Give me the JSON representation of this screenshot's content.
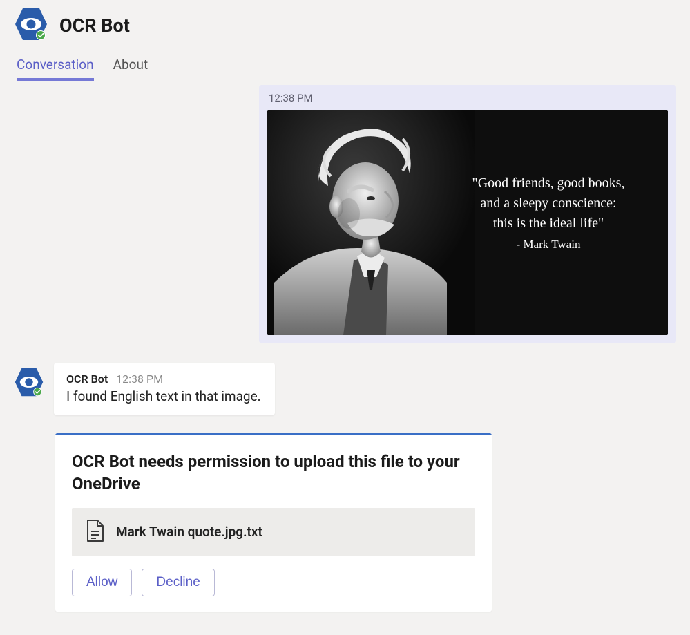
{
  "header": {
    "title": "OCR Bot"
  },
  "tabs": [
    {
      "label": "Conversation",
      "active": true
    },
    {
      "label": "About",
      "active": false
    }
  ],
  "outgoing": {
    "time": "12:38 PM",
    "quote_lines": [
      "\"Good friends, good books,",
      "and a sleepy conscience:",
      "this is the ideal life\""
    ],
    "quote_attr": "- Mark Twain"
  },
  "bot_msg": {
    "name": "OCR Bot",
    "time": "12:38 PM",
    "text": "I found English text in that image."
  },
  "consent": {
    "title": "OCR Bot needs permission to upload this file to your OneDrive",
    "filename": "Mark Twain quote.jpg.txt",
    "allow_label": "Allow",
    "decline_label": "Decline"
  }
}
